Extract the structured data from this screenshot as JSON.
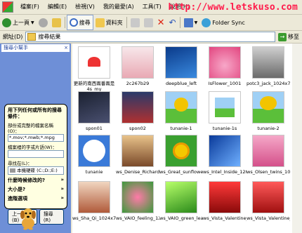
{
  "menubar": {
    "items": [
      "檔案(F)",
      "編輯(E)",
      "檢視(V)",
      "我的最愛(A)",
      "工具(T)",
      "說明(H)"
    ]
  },
  "watermark": "http://www.letskuso.com",
  "toolbar": {
    "back": "上一頁",
    "search": "搜尋",
    "folders": "資料夾",
    "folder_sync": "Folder Sync"
  },
  "address": {
    "label": "網址(D)",
    "value": "搜尋結果",
    "go": "移至"
  },
  "search_panel": {
    "title": "搜尋小幫手",
    "question": "用下列任何或所有的搜尋條件：",
    "name_label": "部份或完整的檔案名稱(O)：",
    "name_value": "*.mov;*.mwb;*.mpg",
    "phrase_label": "檔案裡的字或片語(W)：",
    "phrase_value": "",
    "lookin_label": "尋找在(L)：",
    "lookin_value": "本機硬碟 (C:;D:;E:)",
    "opt1": "什麼時候修改的?",
    "opt2": "大小是?",
    "opt3": "進階選項",
    "back_btn": "上一步(B)",
    "search_btn": "搜尋(R)"
  },
  "files": [
    {
      "name": "更新的南西兩番兩是4s_my"
    },
    {
      "name": "2c267b29"
    },
    {
      "name": "deepblue_left"
    },
    {
      "name": "IsFlower_1001"
    },
    {
      "name": "potc3_jack_1024x768"
    },
    {
      "name": "spon01"
    },
    {
      "name": "spon02"
    },
    {
      "name": "tunanie-1"
    },
    {
      "name": "tunanie-1s"
    },
    {
      "name": "tunanie-2"
    },
    {
      "name": "tunanie"
    },
    {
      "name": "ws_Denise_Richards_1..."
    },
    {
      "name": "ws_Great_sunflower_1..."
    },
    {
      "name": "ws_Intel_Inside_1280x..."
    },
    {
      "name": "ws_Olsen_twins_1024..."
    },
    {
      "name": "ws_Sha_Qi_1024x768"
    },
    {
      "name": "ws_VAIO_feeling_128..."
    },
    {
      "name": "ws_VAIO_green_leafs_..."
    },
    {
      "name": "ws_Vista_Valentine_12..."
    },
    {
      "name": "ws_Vista_Valentine_14..."
    }
  ]
}
